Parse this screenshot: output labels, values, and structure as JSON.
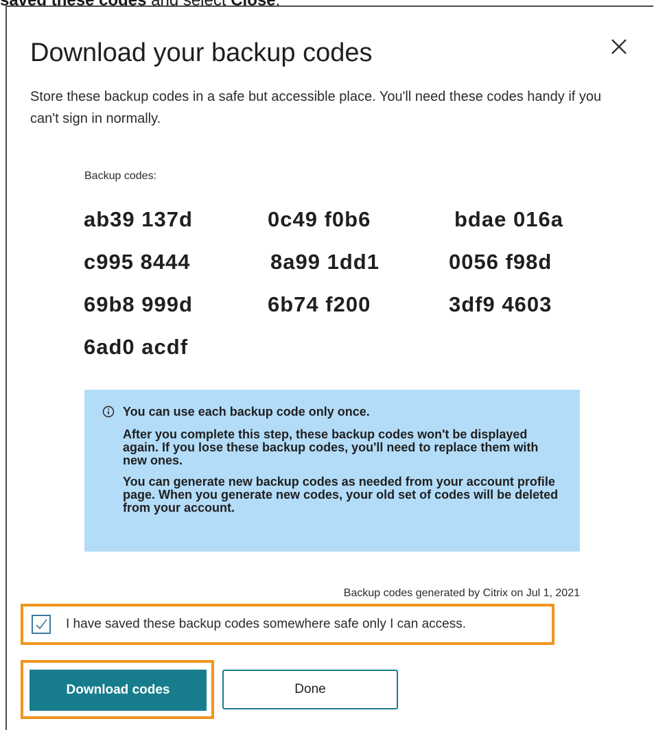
{
  "caption": {
    "bold_text": "saved these codes",
    "mid_text": " and select ",
    "bold_end": "Close",
    "end_text": "."
  },
  "dialog": {
    "title": "Download your backup codes",
    "subtitle": "Store these backup codes in a safe but accessible place. You'll need these codes handy if you can't sign in normally.",
    "close_icon": "close-icon",
    "codes_label": "Backup codes:",
    "codes": [
      "ab39 137d",
      "0c49 f0b6",
      "bdae 016a",
      "c995 8444",
      "8a99 1dd1",
      "0056 f98d",
      "69b8 999d",
      "6b74 f200",
      "3df9 4603",
      "6ad0 acdf"
    ],
    "info": {
      "icon": "info-icon",
      "heading": "You can use each backup code only once.",
      "paragraph1": "After you complete this step, these backup codes won't be displayed again. If you lose these backup codes, you'll need to replace them with new ones.",
      "paragraph2": "You can generate new backup codes as needed from your account profile page. When you generate new codes, your old set of codes will be deleted from your account."
    },
    "generated_note": "Backup codes generated by Citrix on Jul 1, 2021",
    "confirm": {
      "checked": true,
      "label": "I have saved these backup codes somewhere safe only I can access."
    },
    "buttons": {
      "download_label": "Download codes",
      "done_label": "Done"
    }
  },
  "colors": {
    "primary": "#177d8d",
    "info_bg": "#b3dcf8",
    "highlight": "#f0951c"
  }
}
